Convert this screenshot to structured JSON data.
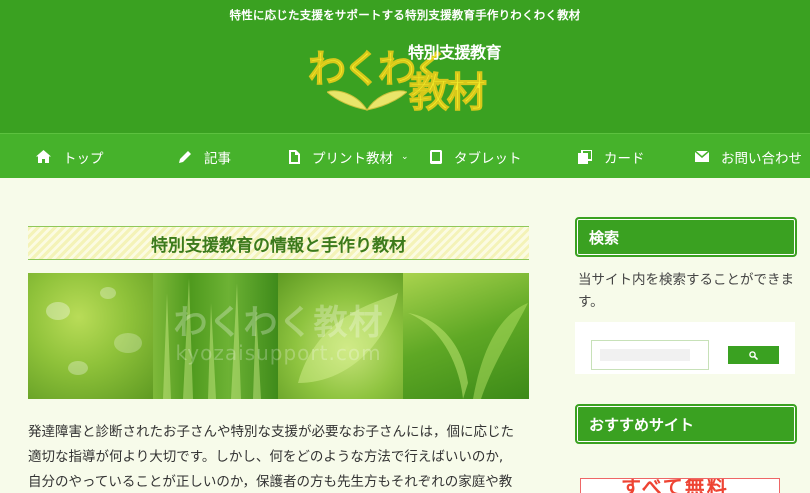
{
  "header": {
    "tagline": "特性に応じた支援をサポートする特別支援教育手作りわくわく教材",
    "logo": {
      "main": "わくわく",
      "sub": "特別支援教育",
      "big": "教材"
    }
  },
  "nav": {
    "items": [
      {
        "label": "トップ",
        "icon": "home-icon"
      },
      {
        "label": "記事",
        "icon": "pencil-icon"
      },
      {
        "label": "プリント教材",
        "icon": "file-icon"
      },
      {
        "label": "タブレット",
        "icon": "tablet-icon"
      },
      {
        "label": "カード",
        "icon": "cards-icon"
      },
      {
        "label": "お問い合わせ",
        "icon": "mail-icon"
      }
    ]
  },
  "main": {
    "title": "特別支援教育の情報と手作り教材",
    "banner_text": "わくわく教材",
    "banner_url": "kyozaisupport.com",
    "intro_lines": [
      "発達障害と診断されたお子さんや特別な支援が必要なお子さんには，個に応じた",
      "適切な指導が何より大切です。しかし、何をどのような方法で行えばいいのか,",
      "自分のやっていることが正しいのか，保護者の方も先生方もそれぞれの家庭や教"
    ]
  },
  "sidebar": {
    "search_title": "検索",
    "search_desc": "当サイト内を検索することができます。",
    "recommend_title": "おすすめサイト",
    "ad_peek_text": "すべて無料"
  },
  "colors": {
    "header_green": "#3aa121",
    "nav_green": "#46b22b",
    "logo_yellow": "#f5ee2a",
    "title_text": "#3c7a1c",
    "page_bg": "#f7fbea"
  }
}
